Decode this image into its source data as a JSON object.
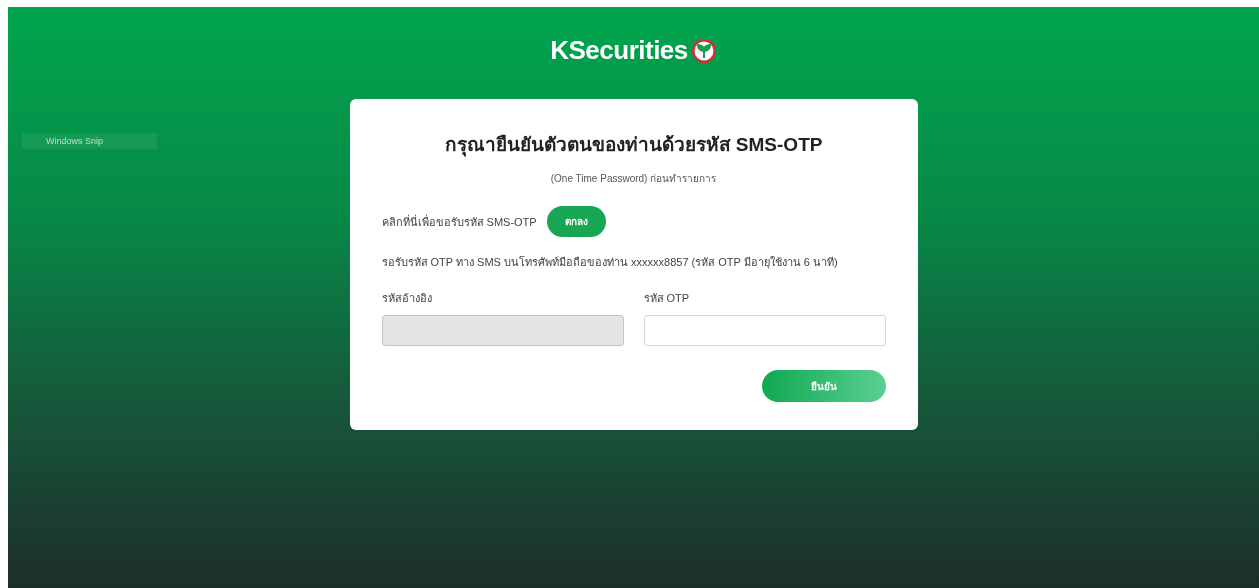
{
  "logo": {
    "text": "**K**Securities"
  },
  "snip_label": {
    "text": "Windows Snip"
  },
  "card": {
    "title": "กรุณายืนยันตัวตนของท่านด้วยรหัส SMS-OTP",
    "subtitle": "(One Time Password) ก่อนทำรายการ",
    "request_label": "คลิกที่นี่เพื่อขอรับรหัส SMS-OTP",
    "request_button": "ตกลง",
    "info": "รอรับรหัส OTP ทาง SMS บนโทรศัพท์มือถือของท่าน xxxxxx8857 (รหัส OTP มีอายุใช้งาน 6 นาที)",
    "fields": [
      {
        "label": "รหัสอ้างอิง",
        "disabled": true
      },
      {
        "label": "รหัส OTP",
        "disabled": false
      }
    ],
    "confirm_button": "ยืนยัน"
  }
}
